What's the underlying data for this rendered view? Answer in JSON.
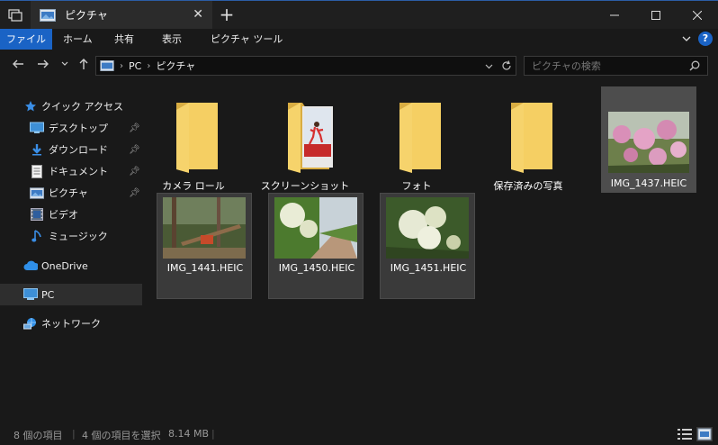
{
  "window": {
    "tab_title": "ピクチャ",
    "new_tab": "+",
    "minimize": "—",
    "maximize": "☐",
    "close": "✕"
  },
  "ribbon": {
    "tabs": [
      "ファイル",
      "ホーム",
      "共有",
      "表示",
      "ピクチャ ツール"
    ],
    "help": "?"
  },
  "address": {
    "crumbs": [
      "PC",
      "ピクチャ"
    ],
    "search_placeholder": "ピクチャの検索"
  },
  "sidebar": {
    "quick_access": "クイック アクセス",
    "items": [
      {
        "label": "デスクトップ",
        "icon": "desktop-icon",
        "pinned": true
      },
      {
        "label": "ダウンロード",
        "icon": "download-icon",
        "pinned": true
      },
      {
        "label": "ドキュメント",
        "icon": "document-icon",
        "pinned": true
      },
      {
        "label": "ピクチャ",
        "icon": "pictures-icon",
        "pinned": true
      },
      {
        "label": "ビデオ",
        "icon": "video-icon",
        "pinned": false
      },
      {
        "label": "ミュージック",
        "icon": "music-icon",
        "pinned": false
      }
    ],
    "onedrive": "OneDrive",
    "pc": "PC",
    "network": "ネットワーク"
  },
  "files": [
    {
      "name": "カメラ ロール",
      "kind": "folder"
    },
    {
      "name": "スクリーンショット",
      "kind": "folder-with-image"
    },
    {
      "name": "フォト",
      "kind": "folder"
    },
    {
      "name": "保存済みの写真",
      "kind": "folder"
    },
    {
      "name": "IMG_1437.HEIC",
      "kind": "image"
    },
    {
      "name": "IMG_1441.HEIC",
      "kind": "image"
    },
    {
      "name": "IMG_1450.HEIC",
      "kind": "image"
    },
    {
      "name": "IMG_1451.HEIC",
      "kind": "image"
    }
  ],
  "status": {
    "count": "8 個の項目",
    "selected": "4 個の項目を選択",
    "size": "8.14 MB"
  },
  "colors": {
    "accent": "#1a63c5",
    "folder": "#f0c75e",
    "background": "#191919"
  }
}
